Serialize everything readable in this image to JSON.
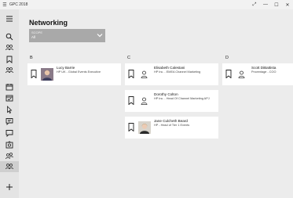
{
  "window": {
    "title": "GPC 2018",
    "back_icon": "hamburger-icon",
    "controls": [
      "expand-icon",
      "minimize-icon",
      "maximize-icon",
      "close-icon"
    ]
  },
  "page": {
    "title": "Networking"
  },
  "filter": {
    "label": "SCOPE",
    "value": "All"
  },
  "nav": {
    "items": [
      "menu-icon",
      "search-icon",
      "people-group-icon",
      "bookmark-icon",
      "people-group-icon",
      "calendar-icon",
      "calendar-check-icon",
      "pointer-icon",
      "chat-icon",
      "feedback-icon",
      "gallery-icon",
      "network-people-icon",
      "networking-icon"
    ],
    "add_icon": "add-icon",
    "active_color": "#cfcfcf"
  },
  "groups": [
    {
      "letter": "B"
    },
    {
      "letter": "C"
    },
    {
      "letter": "D"
    }
  ],
  "people": [
    {
      "name": "Lucy Barrie",
      "subtitle": "HP UK - Global Events Executive",
      "has_photo": true
    },
    {
      "name": "Elisabeth Calestani",
      "subtitle": "HP Inc. - EMEA Channel Marketing",
      "has_photo": false
    },
    {
      "name": "Dorothy Colton",
      "subtitle": "HP Inc. - Head Of Channel Marketing APJ",
      "has_photo": false
    },
    {
      "name": "Jane Culcheth Beard",
      "subtitle": "HP - Head of Tier 1 Events",
      "has_photo": true
    },
    {
      "name": "Scott DiBattista",
      "subtitle": "Proventage - COO",
      "has_photo": false
    }
  ]
}
